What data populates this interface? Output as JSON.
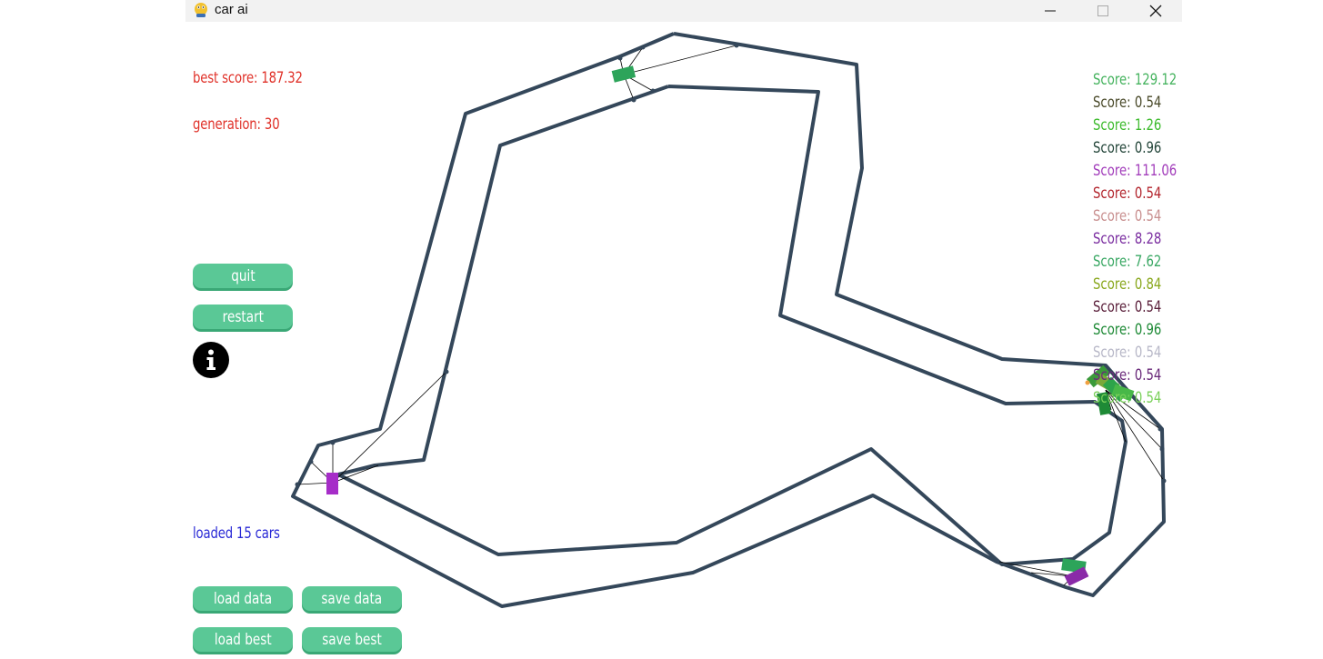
{
  "window": {
    "title": "car ai",
    "minimize_label": "minimize",
    "maximize_label": "maximize",
    "close_label": "close"
  },
  "hud": {
    "best_score": "best score: 187.32",
    "generation": "generation: 30",
    "loaded": "loaded 15 cars"
  },
  "buttons": {
    "quit": "quit",
    "restart": "restart",
    "load_data": "load data",
    "save_data": "save data",
    "load_best": "load best",
    "save_best": "save best",
    "info_icon": "info-icon"
  },
  "colors": {
    "hud_red": "#e0322a",
    "hud_blue": "#2a2ad6",
    "button_green": "#5ac896",
    "track": "#34475a"
  },
  "scores": [
    {
      "text": "Score: 129.12",
      "color": "#45b35e"
    },
    {
      "text": "Score: 0.54",
      "color": "#4a4a2a"
    },
    {
      "text": "Score: 1.26",
      "color": "#3dbb2d"
    },
    {
      "text": "Score: 0.96",
      "color": "#24463a"
    },
    {
      "text": "Score: 111.06",
      "color": "#a23dbb"
    },
    {
      "text": "Score: 0.54",
      "color": "#b3262e"
    },
    {
      "text": "Score: 0.54",
      "color": "#c99090"
    },
    {
      "text": "Score: 8.28",
      "color": "#7a2da0"
    },
    {
      "text": "Score: 7.62",
      "color": "#3aa864"
    },
    {
      "text": "Score: 0.84",
      "color": "#8aa81e"
    },
    {
      "text": "Score: 0.54",
      "color": "#5a1f3a"
    },
    {
      "text": "Score: 0.96",
      "color": "#1e8a36"
    },
    {
      "text": "Score: 0.54",
      "color": "#b8b8c8"
    },
    {
      "text": "Score: 0.54",
      "color": "#6a2a7a"
    },
    {
      "text": "Score: 0.54",
      "color": "#7ad05a"
    }
  ]
}
